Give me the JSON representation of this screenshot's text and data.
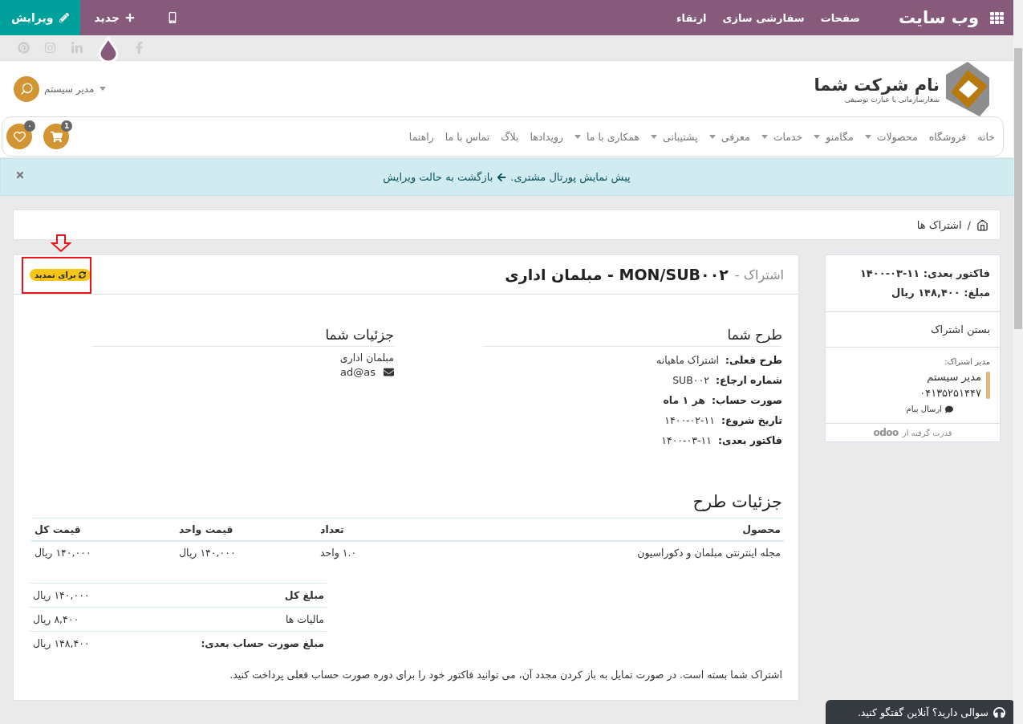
{
  "topbar": {
    "app_title": "وب سایت",
    "menu": [
      "صفحات",
      "سفارشی سازی",
      "ارتقاء"
    ],
    "new_label": "جدید",
    "edit_label": "ویرایش"
  },
  "header": {
    "company_name": "نام شرکت شما",
    "tagline": "شعارسازمانی یا عبارت توصیفی",
    "user": "مدیر سیستم"
  },
  "nav": {
    "items": [
      {
        "label": "خانه",
        "dropdown": false
      },
      {
        "label": "فروشگاه",
        "dropdown": false
      },
      {
        "label": "محصولات",
        "dropdown": true
      },
      {
        "label": "مگامنو",
        "dropdown": true
      },
      {
        "label": "خدمات",
        "dropdown": true
      },
      {
        "label": "معرفی",
        "dropdown": true
      },
      {
        "label": "پشتیبانی",
        "dropdown": true
      },
      {
        "label": "همکاری با ما",
        "dropdown": true
      },
      {
        "label": "رویدادها",
        "dropdown": false
      },
      {
        "label": "بلاگ",
        "dropdown": false
      },
      {
        "label": "تماس با ما",
        "dropdown": false
      },
      {
        "label": "راهنما",
        "dropdown": false
      }
    ],
    "cart_count": "1",
    "wishlist_count": "۰"
  },
  "alert": {
    "text": "پیش نمایش پورتال مشتری.",
    "link": "بازگشت به حالت ویرایش"
  },
  "breadcrumb": {
    "separator": "/",
    "current": "اشتراک ها"
  },
  "subscription": {
    "prefix": "اشتراک -",
    "title": "MON/SUB۰۰۲ - مبلمان اداری",
    "badge": "برای تمدید",
    "plan_heading": "طرح شما",
    "plan_rows": [
      {
        "label": "طرح فعلی:",
        "value": "اشتراک ماهیانه",
        "emphasis": false
      },
      {
        "label": "شماره ارجاع:",
        "value": "SUB۰۰۲",
        "emphasis": false
      },
      {
        "label": "صورت حساب:",
        "value": "هر ۱ ماه",
        "emphasis": true
      },
      {
        "label": "تاریخ شروع:",
        "value": "۱۴۰۰-۰۲-۱۱",
        "emphasis": false
      },
      {
        "label": "فاکتور بعدی:",
        "value": "۱۴۰۰-۰۳-۱۱",
        "emphasis": false
      }
    ],
    "details_heading": "جزئیات شما",
    "customer_name": "مبلمان اداری",
    "email": "ad@as",
    "lines_heading": "جزئیات طرح",
    "table": {
      "columns": [
        "محصول",
        "تعداد",
        "قیمت واحد",
        "قیمت کل"
      ],
      "rows": [
        [
          "مجله اینترنتی مبلمان و دکوراسیون",
          "۱.۰ واحد",
          "۱۴۰,۰۰۰ ریال",
          "۱۴۰,۰۰۰ ریال"
        ]
      ]
    },
    "totals": [
      {
        "label": "مبلغ کل",
        "value": "۱۴۰,۰۰۰ ریال",
        "emphasis": true
      },
      {
        "label": "مالیات ها",
        "value": "۸,۴۰۰ ریال",
        "emphasis": false
      },
      {
        "label": "مبلغ صورت حساب بعدی:",
        "value": "۱۴۸,۴۰۰ ریال",
        "emphasis": true
      }
    ],
    "note": "اشتراک شما بسته است. در صورت تمایل به باز کردن مجدد آن، می توانید فاکتور خود را برای دوره صورت حساب فعلی پرداخت کنید."
  },
  "sidebar": {
    "next_invoice": "فاکتور بعدی: ۱۱-۰۳-۱۴۰۰",
    "amount": "مبلغ: ۱۴۸,۴۰۰ ریال",
    "close_link": "بستن اشتراک",
    "manager_label": "مدیر اشتراک:",
    "manager_name": "مدیر سیستم",
    "manager_phone": "۰۴۱۳۵۲۵۱۴۴۷",
    "message_link": "ارسال پیام",
    "powered_by": "قدرت گرفته از",
    "powered_logo": "odoo"
  },
  "chat": {
    "text": "سوالی دارید؟ آنلاین گفتگو کنید."
  }
}
